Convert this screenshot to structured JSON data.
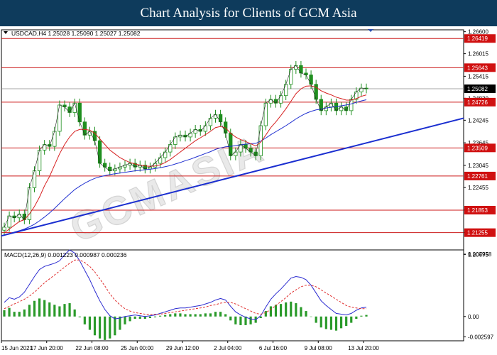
{
  "header": {
    "title": "Chart Analysis for Clients of GCM Asia"
  },
  "colors": {
    "header_bg": "#0e3b5c",
    "candle": "#1f8f1f",
    "ma_red": "#d62020",
    "ma_blue": "#2030d0",
    "trendline": "#1a2ed0",
    "level_line": "#cc1a1a",
    "macd_line": "#2a2ad0",
    "signal_line": "#e03030",
    "histogram": "#2a9a2a"
  },
  "watermark": "GCMASIA",
  "chart_data": [
    {
      "type": "candlestick",
      "symbol_info": "USDCAD,H4  1.25028 1.25090 1.25027 1.25082",
      "ylim": [
        1.2055,
        1.2665
      ],
      "y_ticks": [
        "1.26600",
        "1.26015",
        "1.25415",
        "1.24830",
        "1.24245",
        "1.23645",
        "1.23045",
        "1.22455",
        "1.21855",
        "1.21255",
        "1.20675"
      ],
      "levels": [
        {
          "value": 1.26419,
          "label": "1.26419",
          "color": "#d01010"
        },
        {
          "value": 1.25643,
          "label": "1.25643",
          "color": "#d01010"
        },
        {
          "value": 1.24726,
          "label": "1.24726",
          "color": "#d01010"
        },
        {
          "value": 1.23509,
          "label": "1.23509",
          "color": "#d01010"
        },
        {
          "value": 1.22761,
          "label": "1.22761",
          "color": "#d01010"
        },
        {
          "value": 1.21853,
          "label": "1.21853",
          "color": "#d01010"
        },
        {
          "value": 1.21255,
          "label": "1.21255",
          "color": "#d01010"
        }
      ],
      "current_price": {
        "value": 1.25082,
        "label": "1.25082",
        "color": "#000000"
      },
      "close": [
        1.214,
        1.217,
        1.2165,
        1.2175,
        1.216,
        1.2245,
        1.229,
        1.2345,
        1.236,
        1.2355,
        1.2395,
        1.2465,
        1.246,
        1.2445,
        1.247,
        1.242,
        1.2385,
        1.2395,
        1.237,
        1.231,
        1.23,
        1.229,
        1.2295,
        1.23,
        1.2305,
        1.231,
        1.23,
        1.2305,
        1.2295,
        1.23,
        1.231,
        1.2325,
        1.234,
        1.236,
        1.238,
        1.2385,
        1.238,
        1.239,
        1.24,
        1.2395,
        1.241,
        1.243,
        1.244,
        1.242,
        1.239,
        1.233,
        1.234,
        1.236,
        1.235,
        1.234,
        1.233,
        1.241,
        1.247,
        1.248,
        1.247,
        1.249,
        1.252,
        1.256,
        1.257,
        1.255,
        1.2545,
        1.252,
        1.248,
        1.245,
        1.246,
        1.247,
        1.245,
        1.246,
        1.245,
        1.248,
        1.25,
        1.251,
        1.2508
      ],
      "ma_red": [
        1.2125,
        1.2135,
        1.2145,
        1.2155,
        1.216,
        1.2175,
        1.2195,
        1.222,
        1.225,
        1.2275,
        1.2305,
        1.2335,
        1.236,
        1.238,
        1.2395,
        1.24,
        1.24,
        1.2398,
        1.239,
        1.2375,
        1.236,
        1.2345,
        1.2335,
        1.2325,
        1.2318,
        1.2312,
        1.2308,
        1.2305,
        1.2303,
        1.2302,
        1.2303,
        1.2306,
        1.2312,
        1.232,
        1.233,
        1.234,
        1.235,
        1.236,
        1.237,
        1.2378,
        1.2386,
        1.2395,
        1.2405,
        1.2408,
        1.2404,
        1.239,
        1.238,
        1.2373,
        1.2368,
        1.2362,
        1.2356,
        1.2366,
        1.2385,
        1.2405,
        1.242,
        1.2437,
        1.2455,
        1.2475,
        1.2495,
        1.2508,
        1.2515,
        1.2516,
        1.2512,
        1.2503,
        1.2497,
        1.2492,
        1.2486,
        1.2482,
        1.2478,
        1.2478,
        1.2482,
        1.2488,
        1.2492
      ],
      "ma_blue": [
        1.212,
        1.2123,
        1.2127,
        1.2131,
        1.2135,
        1.2141,
        1.2148,
        1.2157,
        1.2167,
        1.2178,
        1.219,
        1.2203,
        1.2216,
        1.2228,
        1.224,
        1.2249,
        1.2257,
        1.2264,
        1.227,
        1.2274,
        1.2277,
        1.228,
        1.2282,
        1.2284,
        1.2286,
        1.2288,
        1.229,
        1.2291,
        1.2293,
        1.2294,
        1.2296,
        1.2298,
        1.2301,
        1.2304,
        1.2308,
        1.2312,
        1.2317,
        1.2321,
        1.2326,
        1.2331,
        1.2336,
        1.2341,
        1.2347,
        1.2351,
        1.2354,
        1.2355,
        1.2357,
        1.2359,
        1.2361,
        1.2362,
        1.2363,
        1.2369,
        1.2377,
        1.2386,
        1.2394,
        1.2402,
        1.241,
        1.2419,
        1.2428,
        1.2436,
        1.2443,
        1.2448,
        1.2452,
        1.2454,
        1.2457,
        1.2459,
        1.2461,
        1.2463,
        1.2465,
        1.2468,
        1.2472,
        1.2476,
        1.2479
      ],
      "trendline": [
        1.2117,
        1.243
      ]
    },
    {
      "type": "macd",
      "label": "MACD(12,26,9) 0.001223 0.000987 0.000236",
      "ylim": [
        -0.0031,
        0.0085
      ],
      "y_ticks": [
        "0.007958",
        "0.00",
        "-0.002597"
      ],
      "x_labels": [
        "15 Jun 2021",
        "17 Jun 20:00",
        "22 Jun 08:00",
        "25 Jun 00:00",
        "29 Jun 12:00",
        "2 Jul 04:00",
        "6 Jul 16:00",
        "9 Jul 08:00",
        "13 Jul 20:00"
      ],
      "macd": [
        0.0018,
        0.0024,
        0.0022,
        0.0025,
        0.0031,
        0.0041,
        0.0051,
        0.006,
        0.0064,
        0.0066,
        0.0068,
        0.0071,
        0.0079,
        0.0085,
        0.0081,
        0.0071,
        0.0059,
        0.0047,
        0.0033,
        0.002,
        0.0009,
        0.0001,
        -0.0003,
        -0.0002,
        0.0,
        0.0001,
        0.0002,
        0.0001,
        0.0,
        0.0001,
        0.0002,
        0.0004,
        0.0006,
        0.0008,
        0.001,
        0.0011,
        0.0011,
        0.0012,
        0.0013,
        0.0014,
        0.0016,
        0.0018,
        0.0021,
        0.0023,
        0.0021,
        0.0013,
        0.0006,
        0.0002,
        -0.0001,
        -0.0003,
        -0.0004,
        0.0001,
        0.0012,
        0.0022,
        0.0029,
        0.0035,
        0.0042,
        0.0049,
        0.0051,
        0.005,
        0.0047,
        0.004,
        0.003,
        0.002,
        0.0014,
        0.0009,
        0.0004,
        0.0003,
        0.0002,
        0.0004,
        0.0008,
        0.0011,
        0.0012
      ],
      "signal": [
        0.001,
        0.0013,
        0.0016,
        0.0019,
        0.0022,
        0.0026,
        0.0031,
        0.0037,
        0.0043,
        0.0048,
        0.0053,
        0.0058,
        0.0063,
        0.0068,
        0.0072,
        0.0072,
        0.0069,
        0.0064,
        0.0057,
        0.0048,
        0.0039,
        0.0029,
        0.0021,
        0.0015,
        0.001,
        0.0007,
        0.0005,
        0.0004,
        0.0003,
        0.0003,
        0.0003,
        0.0003,
        0.0004,
        0.0005,
        0.0006,
        0.0007,
        0.0008,
        0.0009,
        0.001,
        0.0011,
        0.0012,
        0.0014,
        0.0015,
        0.0017,
        0.0018,
        0.0018,
        0.0016,
        0.0013,
        0.001,
        0.0007,
        0.0004,
        0.0003,
        0.0005,
        0.0009,
        0.0014,
        0.0019,
        0.0024,
        0.003,
        0.0034,
        0.0038,
        0.004,
        0.004,
        0.0038,
        0.0034,
        0.003,
        0.0026,
        0.0022,
        0.0018,
        0.0014,
        0.0012,
        0.0011,
        0.001,
        0.001
      ],
      "histogram": [
        0.0008,
        0.0011,
        0.0006,
        0.0006,
        0.0009,
        0.0015,
        0.002,
        0.0023,
        0.0021,
        0.0018,
        0.0015,
        0.0013,
        0.0016,
        0.0017,
        0.0009,
        -0.0001,
        -0.001,
        -0.0017,
        -0.0024,
        -0.0028,
        -0.003,
        -0.0028,
        -0.0024,
        -0.0017,
        -0.001,
        -0.0006,
        -0.0003,
        -0.0003,
        -0.0003,
        -0.0002,
        -0.0001,
        0.0001,
        0.0002,
        0.0003,
        0.0004,
        0.0004,
        0.0003,
        0.0003,
        0.0003,
        0.0003,
        0.0004,
        0.0004,
        0.0006,
        0.0006,
        0.0003,
        -0.0005,
        -0.001,
        -0.0011,
        -0.0011,
        -0.001,
        -0.0008,
        -0.0002,
        0.0007,
        0.0013,
        0.0015,
        0.0016,
        0.0018,
        0.0019,
        0.0017,
        0.0012,
        0.0007,
        0.0,
        -0.0008,
        -0.0014,
        -0.0016,
        -0.0017,
        -0.0018,
        -0.0015,
        -0.0012,
        -0.0008,
        -0.0003,
        0.0001,
        0.0002
      ]
    }
  ]
}
